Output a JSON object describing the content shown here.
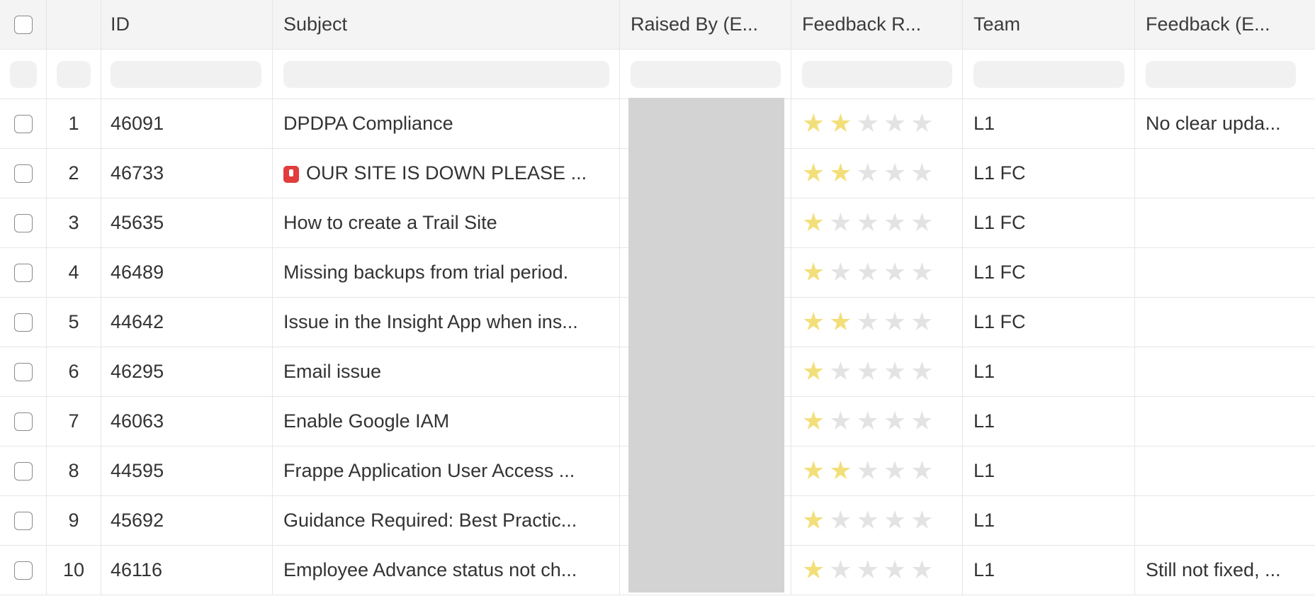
{
  "columns": {
    "id": "ID",
    "subject": "Subject",
    "raised_by": "Raised By (E...",
    "feedback_rating": "Feedback R...",
    "team": "Team",
    "feedback": "Feedback (E..."
  },
  "rows": [
    {
      "index": "1",
      "id": "46091",
      "subject": "DPDPA Compliance",
      "rating": 2,
      "team": "L1",
      "feedback": "No clear upda..."
    },
    {
      "index": "2",
      "id": "46733",
      "subject": "OUR SITE IS DOWN PLEASE ...",
      "subject_icon": "siren-icon",
      "rating": 2,
      "team": "L1 FC",
      "feedback": ""
    },
    {
      "index": "3",
      "id": "45635",
      "subject": "How to create a Trail Site",
      "rating": 1,
      "team": "L1 FC",
      "feedback": ""
    },
    {
      "index": "4",
      "id": "46489",
      "subject": "Missing backups from trial period.",
      "rating": 1,
      "team": "L1 FC",
      "feedback": ""
    },
    {
      "index": "5",
      "id": "44642",
      "subject": "Issue in the Insight App when ins...",
      "rating": 2,
      "team": "L1 FC",
      "feedback": ""
    },
    {
      "index": "6",
      "id": "46295",
      "subject": "Email issue",
      "rating": 1,
      "team": "L1",
      "feedback": ""
    },
    {
      "index": "7",
      "id": "46063",
      "subject": "Enable Google IAM",
      "rating": 1,
      "team": "L1",
      "feedback": ""
    },
    {
      "index": "8",
      "id": "44595",
      "subject": "Frappe Application User Access ...",
      "rating": 2,
      "team": "L1",
      "feedback": ""
    },
    {
      "index": "9",
      "id": "45692",
      "subject": "Guidance Required: Best Practic...",
      "rating": 1,
      "team": "L1",
      "feedback": ""
    },
    {
      "index": "10",
      "id": "46116",
      "subject": "Employee Advance status not ch...",
      "rating": 1,
      "team": "L1",
      "feedback": "Still not fixed, ..."
    }
  ],
  "colors": {
    "star_on": "#f3df7a",
    "star_off": "#e3e3e3",
    "redacted": "#d3d3d3"
  }
}
